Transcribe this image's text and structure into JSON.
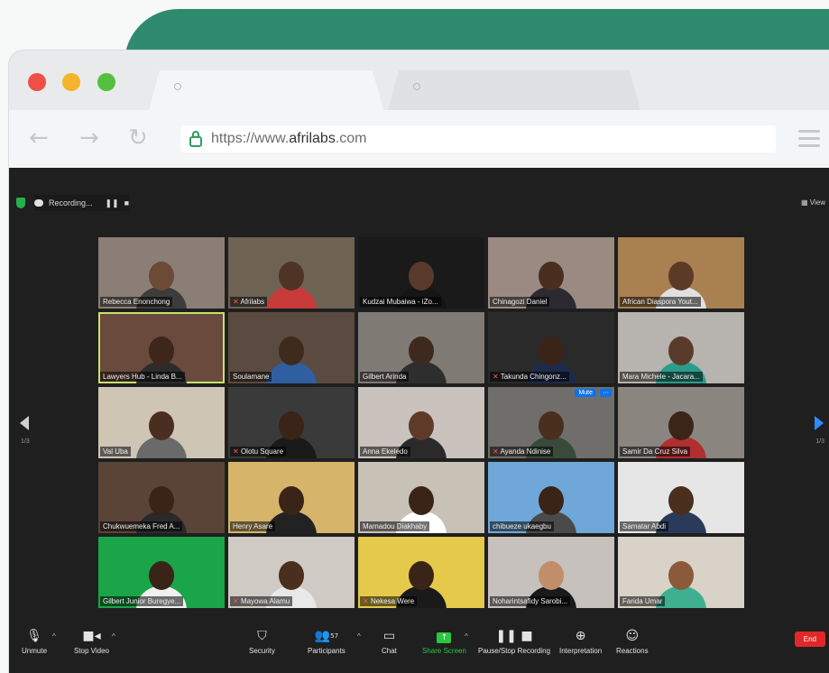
{
  "browser": {
    "url_prefix": "https://www.",
    "url_domain": "afrilabs",
    "url_suffix": ".com"
  },
  "zoom": {
    "recording_label": "Recording...",
    "view_label": "View",
    "page_indicator_left": "1/3",
    "page_indicator_right": "1/3",
    "tiles": [
      {
        "name": "Rebecca Enonchong",
        "muted": false,
        "bg": "#8a7e76",
        "skin": "#6b4a36",
        "shirt": "#3c3c3c"
      },
      {
        "name": "Afrilabs",
        "muted": true,
        "bg": "#6e6253",
        "skin": "#4f3325",
        "shirt": "#c83a3a"
      },
      {
        "name": "Kudzai Mubaiwa - iZo...",
        "muted": false,
        "bg": "#1a1a1a",
        "skin": "#5a3a2a",
        "shirt": "#151515"
      },
      {
        "name": "Chinagozi Daniel",
        "muted": false,
        "bg": "#9a8a82",
        "skin": "#4a2e20",
        "shirt": "#2a2a30"
      },
      {
        "name": "African Diaspora Yout...",
        "muted": false,
        "bg": "#a98050",
        "skin": "#5b3a28",
        "shirt": "#e0e0e0"
      },
      {
        "name": "Lawyers Hub - Linda B...",
        "muted": false,
        "bg": "#6a4a3c",
        "skin": "#3d261a",
        "shirt": "#2c2c2c",
        "active": true
      },
      {
        "name": "Soulamane",
        "muted": false,
        "bg": "#5a4a3f",
        "skin": "#3f2a1e",
        "shirt": "#2f5fa0"
      },
      {
        "name": "Gilbert Arinda",
        "muted": false,
        "bg": "#807a74",
        "skin": "#3d291d",
        "shirt": "#2e2e2e"
      },
      {
        "name": "Takunda Chingonz...",
        "muted": true,
        "bg": "#2a2a2a",
        "skin": "#3a2418",
        "shirt": "#1d2a4a"
      },
      {
        "name": "Mara Michele - Jacara...",
        "muted": false,
        "bg": "#b7b3ae",
        "skin": "#5a3a2a",
        "shirt": "#2a9c8a"
      },
      {
        "name": "Val Uba",
        "muted": false,
        "bg": "#cfc5b5",
        "skin": "#4a2e1f",
        "shirt": "#6a6a6a"
      },
      {
        "name": "Olotu Square",
        "muted": true,
        "bg": "#3a3a3a",
        "skin": "#3a2418",
        "shirt": "#1a1a1a"
      },
      {
        "name": "Anna Ekeledo",
        "muted": false,
        "bg": "#c9c2bd",
        "skin": "#5e3b28",
        "shirt": "#2a2a2a"
      },
      {
        "name": "Ayanda Ndinise",
        "muted": true,
        "bg": "#6f6e6a",
        "skin": "#4a2e1e",
        "shirt": "#3a4a3a",
        "badge": "Mute"
      },
      {
        "name": "Samir Da Cruz Silva",
        "muted": false,
        "bg": "#8b8580",
        "skin": "#3b2418",
        "shirt": "#b03030"
      },
      {
        "name": "Chukwuemeka Fred A...",
        "muted": false,
        "bg": "#5a4438",
        "skin": "#3a2418",
        "shirt": "#2a2a2a"
      },
      {
        "name": "Henry Asare",
        "muted": false,
        "bg": "#d6b46a",
        "skin": "#3a2418",
        "shirt": "#222222"
      },
      {
        "name": "Mamadou Diakhaby",
        "muted": false,
        "bg": "#c8c1b6",
        "skin": "#3a2418",
        "shirt": "#ffffff"
      },
      {
        "name": "chibueze ukaegbu",
        "muted": false,
        "bg": "#6fa7d8",
        "skin": "#3a2418",
        "shirt": "#4a4a4a"
      },
      {
        "name": "Samatar Abdi",
        "muted": false,
        "bg": "#e6e6e6",
        "skin": "#4a2e1e",
        "shirt": "#2a3a5a"
      },
      {
        "name": "Gilbert Junior Buregye...",
        "muted": false,
        "bg": "#1aa548",
        "skin": "#3a2418",
        "shirt": "#f0f0f0"
      },
      {
        "name": "Mayowa Alamu",
        "muted": true,
        "bg": "#cfcac3",
        "skin": "#4a2e1e",
        "shirt": "#e8e8e8"
      },
      {
        "name": "Nekesa Were",
        "muted": true,
        "bg": "#e5c94a",
        "skin": "#3a2418",
        "shirt": "#1a1a1a"
      },
      {
        "name": "Noharintsafidy Sarobi...",
        "muted": false,
        "bg": "#c6c1bc",
        "skin": "#c28d6a",
        "shirt": "#1a1a1a"
      },
      {
        "name": "Farida Umar",
        "muted": false,
        "bg": "#d9d2c8",
        "skin": "#8a5a3a",
        "shirt": "#3fb08f"
      }
    ],
    "controls": {
      "unmute": "Unmute",
      "stop_video": "Stop Video",
      "security": "Security",
      "participants": "Participants",
      "participants_count": "57",
      "chat": "Chat",
      "share_screen": "Share Screen",
      "pause_recording": "Pause/Stop Recording",
      "interpretation": "Interpretation",
      "reactions": "Reactions",
      "end": "End"
    }
  },
  "icons": {
    "back": "back-arrow-icon",
    "forward": "forward-arrow-icon",
    "reload": "reload-icon",
    "lock": "lock-icon",
    "menu": "hamburger-menu-icon"
  },
  "colors": {
    "browser_bg": "#e9eaeb",
    "accent_green": "#2f8b6e",
    "zoom_bg": "#1f1f1f",
    "end_red": "#e02828",
    "share_green": "#28c840"
  }
}
